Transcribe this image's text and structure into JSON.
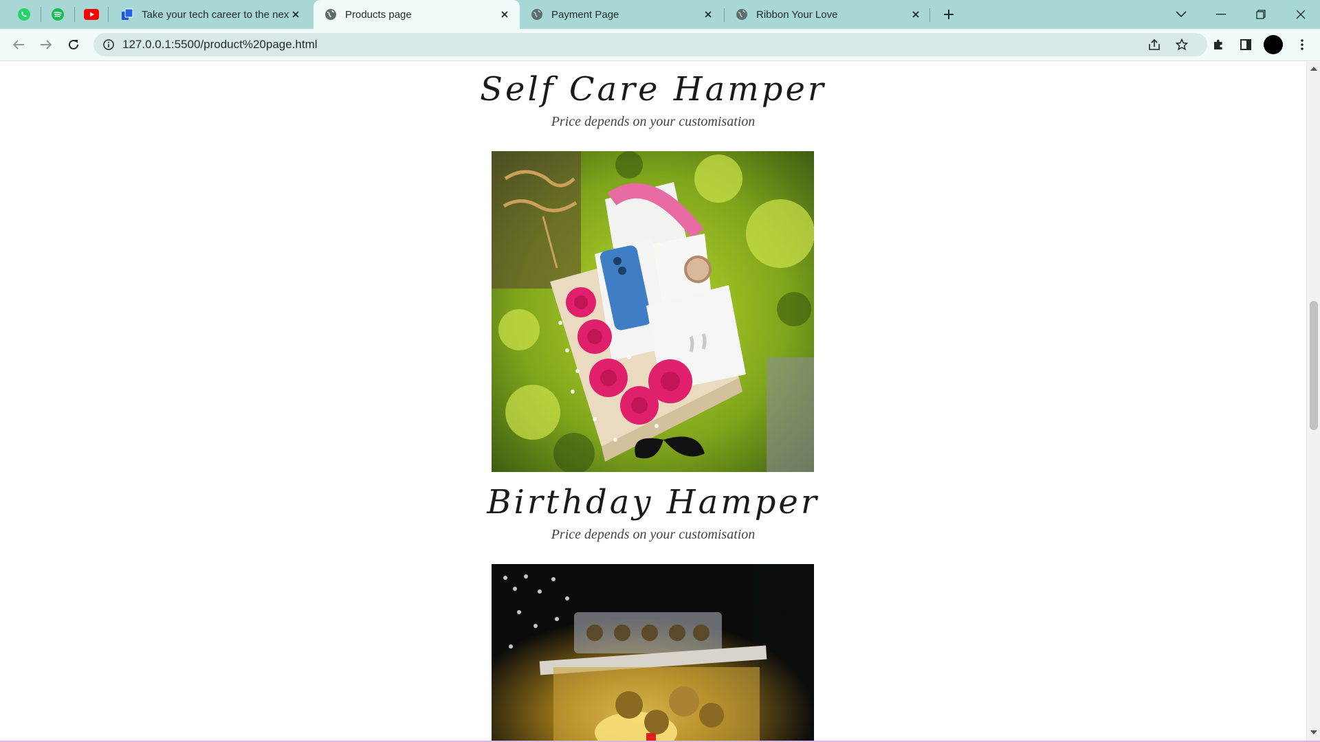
{
  "browser": {
    "pinned_tabs": [
      {
        "icon": "whatsapp-icon",
        "color": "#25d366"
      },
      {
        "icon": "spotify-icon",
        "color": "#1db954"
      },
      {
        "icon": "youtube-icon",
        "color": "#ff0000"
      }
    ],
    "tabs": [
      {
        "title": "Take your tech career to the next",
        "icon": "course-site-icon",
        "active": false
      },
      {
        "title": "Products page",
        "icon": "globe-icon",
        "active": true
      },
      {
        "title": "Payment Page",
        "icon": "globe-icon",
        "active": false
      },
      {
        "title": "Ribbon Your Love",
        "icon": "globe-icon",
        "active": false
      }
    ],
    "address": {
      "url": "127.0.0.1:5500/product%20page.html"
    },
    "colors": {
      "tab_strip": "#a8d8d5",
      "toolbar": "#f2fbfb",
      "omnibox": "#d9e8e8"
    }
  },
  "page": {
    "products": [
      {
        "name": "Self Care Hamper",
        "price_note": "Price depends on your customisation"
      },
      {
        "name": "Birthday Hamper",
        "price_note": "Price depends on your customisation"
      }
    ],
    "photos": [
      {
        "subject": "gift-box-with-phone-watch-earbuds-roses"
      },
      {
        "subject": "chocolate-box-with-flowers"
      }
    ]
  }
}
